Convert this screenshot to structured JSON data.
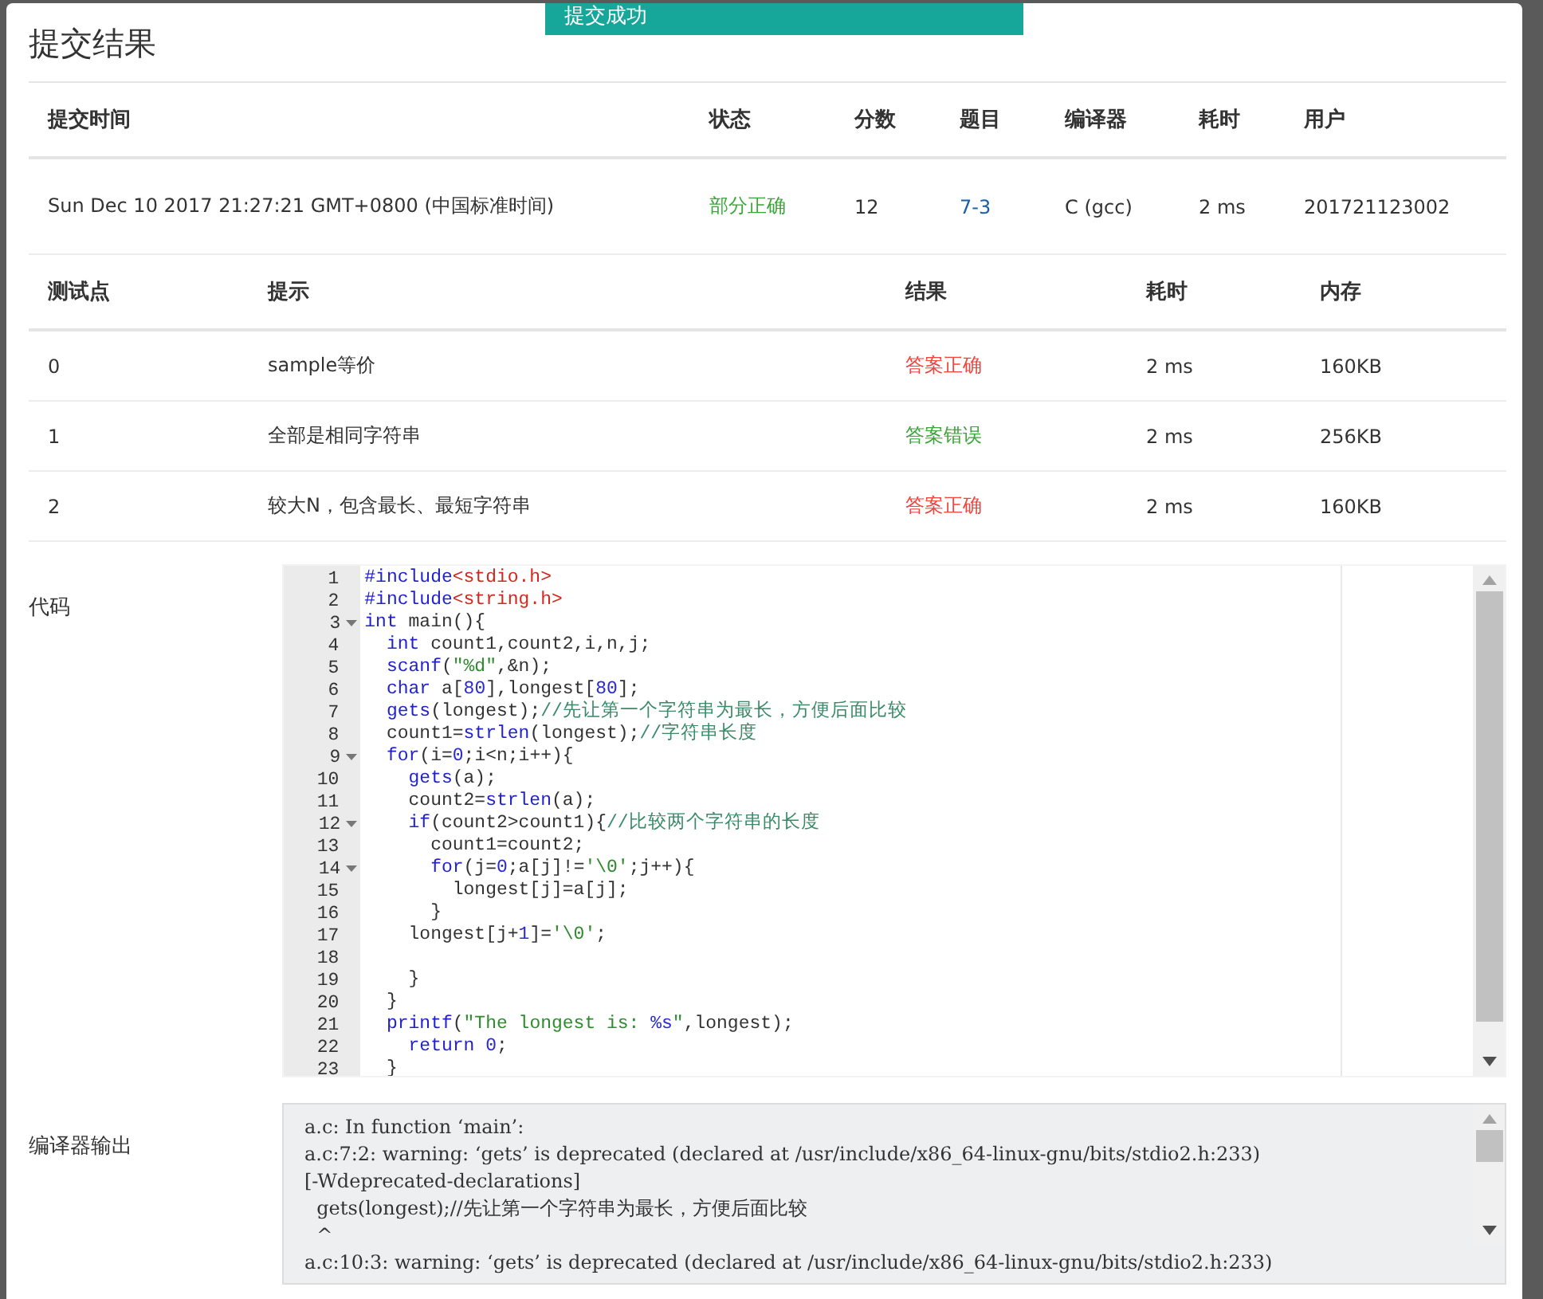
{
  "toast": {
    "text": "提交成功"
  },
  "title": "提交结果",
  "submission": {
    "columns": [
      "提交时间",
      "状态",
      "分数",
      "题目",
      "编译器",
      "耗时",
      "用户"
    ],
    "row": {
      "time": "Sun Dec 10 2017 21:27:21 GMT+0800 (中国标准时间)",
      "status": {
        "text": "部分正确",
        "kind": "partial"
      },
      "score": "12",
      "problem": "7-3",
      "compiler": "C (gcc)",
      "duration": "2 ms",
      "user": "201721123002"
    }
  },
  "tests": {
    "columns": [
      "测试点",
      "提示",
      "结果",
      "耗时",
      "内存"
    ],
    "rows": [
      {
        "id": "0",
        "hint": "sample等价",
        "result": {
          "text": "答案正确",
          "kind": "fail"
        },
        "duration": "2 ms",
        "memory": "160KB"
      },
      {
        "id": "1",
        "hint": "全部是相同字符串",
        "result": {
          "text": "答案错误",
          "kind": "pass"
        },
        "duration": "2 ms",
        "memory": "256KB"
      },
      {
        "id": "2",
        "hint": "较大N，包含最长、最短字符串",
        "result": {
          "text": "答案正确",
          "kind": "fail"
        },
        "duration": "2 ms",
        "memory": "160KB"
      }
    ]
  },
  "code": {
    "label": "代码",
    "lines": [
      {
        "no": "1",
        "fold": false,
        "tokens": [
          {
            "kind": "kw",
            "text": "#include"
          },
          {
            "kind": "hdr",
            "text": "<stdio.h>"
          }
        ]
      },
      {
        "no": "2",
        "fold": false,
        "tokens": [
          {
            "kind": "kw",
            "text": "#include"
          },
          {
            "kind": "hdr",
            "text": "<string.h>"
          }
        ]
      },
      {
        "no": "3",
        "fold": true,
        "tokens": [
          {
            "kind": "kw",
            "text": "int"
          },
          {
            "kind": "p",
            "text": " main(){"
          }
        ]
      },
      {
        "no": "4",
        "fold": false,
        "tokens": [
          {
            "kind": "kw",
            "text": "  int"
          },
          {
            "kind": "p",
            "text": " count1,count2,i,n,j;"
          }
        ]
      },
      {
        "no": "5",
        "fold": false,
        "tokens": [
          {
            "kind": "kw",
            "text": "  scanf"
          },
          {
            "kind": "p",
            "text": "("
          },
          {
            "kind": "str",
            "text": "\"%d\""
          },
          {
            "kind": "p",
            "text": ",&n);"
          }
        ]
      },
      {
        "no": "6",
        "fold": false,
        "tokens": [
          {
            "kind": "kw",
            "text": "  char"
          },
          {
            "kind": "p",
            "text": " a["
          },
          {
            "kind": "num",
            "text": "80"
          },
          {
            "kind": "p",
            "text": "],longest["
          },
          {
            "kind": "num",
            "text": "80"
          },
          {
            "kind": "p",
            "text": "];"
          }
        ]
      },
      {
        "no": "7",
        "fold": false,
        "tokens": [
          {
            "kind": "kw",
            "text": "  gets"
          },
          {
            "kind": "p",
            "text": "(longest);"
          },
          {
            "kind": "cm",
            "text": "//先让第一个字符串为最长，方便后面比较"
          }
        ]
      },
      {
        "no": "8",
        "fold": false,
        "tokens": [
          {
            "kind": "p",
            "text": "  count1="
          },
          {
            "kind": "kw",
            "text": "strlen"
          },
          {
            "kind": "p",
            "text": "(longest);"
          },
          {
            "kind": "cm",
            "text": "//字符串长度"
          }
        ]
      },
      {
        "no": "9",
        "fold": true,
        "tokens": [
          {
            "kind": "kw",
            "text": "  for"
          },
          {
            "kind": "p",
            "text": "(i="
          },
          {
            "kind": "num",
            "text": "0"
          },
          {
            "kind": "p",
            "text": ";i<n;i++){"
          }
        ]
      },
      {
        "no": "10",
        "fold": false,
        "tokens": [
          {
            "kind": "kw",
            "text": "    gets"
          },
          {
            "kind": "p",
            "text": "(a);"
          }
        ]
      },
      {
        "no": "11",
        "fold": false,
        "tokens": [
          {
            "kind": "p",
            "text": "    count2="
          },
          {
            "kind": "kw",
            "text": "strlen"
          },
          {
            "kind": "p",
            "text": "(a);"
          }
        ]
      },
      {
        "no": "12",
        "fold": true,
        "tokens": [
          {
            "kind": "kw",
            "text": "    if"
          },
          {
            "kind": "p",
            "text": "(count2>count1){"
          },
          {
            "kind": "cm",
            "text": "//比较两个字符串的长度"
          }
        ]
      },
      {
        "no": "13",
        "fold": false,
        "tokens": [
          {
            "kind": "p",
            "text": "      count1=count2;"
          }
        ]
      },
      {
        "no": "14",
        "fold": true,
        "tokens": [
          {
            "kind": "kw",
            "text": "      for"
          },
          {
            "kind": "p",
            "text": "(j="
          },
          {
            "kind": "num",
            "text": "0"
          },
          {
            "kind": "p",
            "text": ";a[j]!="
          },
          {
            "kind": "str",
            "text": "'\\0'"
          },
          {
            "kind": "p",
            "text": ";j++){"
          }
        ]
      },
      {
        "no": "15",
        "fold": false,
        "tokens": [
          {
            "kind": "p",
            "text": "        longest[j]=a[j];"
          }
        ]
      },
      {
        "no": "16",
        "fold": false,
        "tokens": [
          {
            "kind": "p",
            "text": "      }"
          }
        ]
      },
      {
        "no": "17",
        "fold": false,
        "tokens": [
          {
            "kind": "p",
            "text": "    longest[j+"
          },
          {
            "kind": "num",
            "text": "1"
          },
          {
            "kind": "p",
            "text": "]="
          },
          {
            "kind": "str",
            "text": "'\\0'"
          },
          {
            "kind": "p",
            "text": ";"
          }
        ]
      },
      {
        "no": "18",
        "fold": false
      },
      {
        "no": "19",
        "fold": false,
        "tokens": [
          {
            "kind": "p",
            "text": "    }"
          }
        ]
      },
      {
        "no": "20",
        "fold": false,
        "tokens": [
          {
            "kind": "p",
            "text": "  }"
          }
        ]
      },
      {
        "no": "21",
        "fold": false,
        "tokens": [
          {
            "kind": "kw",
            "text": "  printf"
          },
          {
            "kind": "p",
            "text": "("
          },
          {
            "kind": "str",
            "text": "\"The longest is: "
          },
          {
            "kind": "num",
            "text": "%s"
          },
          {
            "kind": "str",
            "text": "\""
          },
          {
            "kind": "p",
            "text": ",longest);"
          }
        ]
      },
      {
        "no": "22",
        "fold": false,
        "tokens": [
          {
            "kind": "kw",
            "text": "    return"
          },
          {
            "kind": "num",
            "text": " 0"
          },
          {
            "kind": "p",
            "text": ";"
          }
        ]
      },
      {
        "no": "23",
        "fold": false,
        "tokens": [
          {
            "kind": "p",
            "text": "  }"
          }
        ]
      }
    ]
  },
  "compiler_output": {
    "label": "编译器输出",
    "lines": [
      "a.c: In function ‘main’:",
      "a.c:7:2: warning: ‘gets’ is deprecated (declared at /usr/include/x86_64-linux-gnu/bits/stdio2.h:233)",
      "[-Wdeprecated-declarations]",
      "  gets(longest);//先让第一个字符串为最长，方便后面比较",
      "  ^",
      "a.c:10:3: warning: ‘gets’ is deprecated (declared at /usr/include/x86_64-linux-gnu/bits/stdio2.h:233)"
    ]
  }
}
